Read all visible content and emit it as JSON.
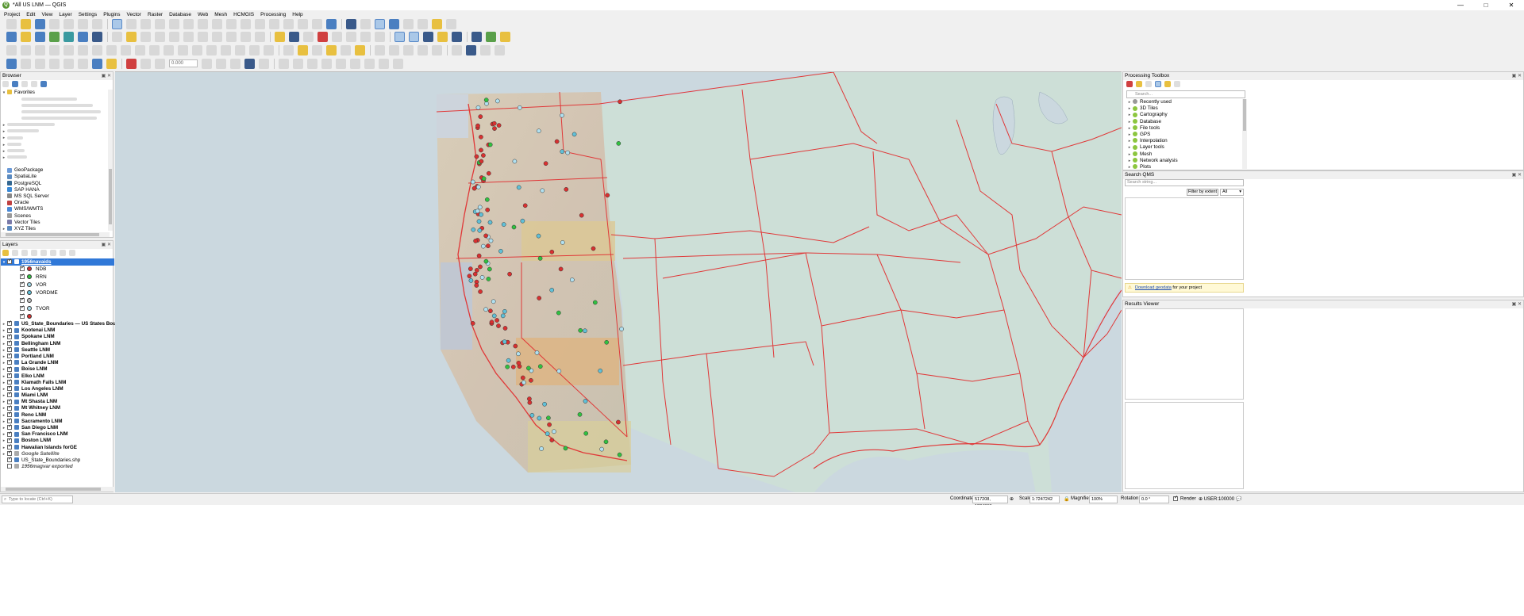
{
  "window": {
    "title": "*All US LNM — QGIS",
    "controls": [
      "—",
      "□",
      "✕"
    ]
  },
  "menu": [
    "Project",
    "Edit",
    "View",
    "Layer",
    "Settings",
    "Plugins",
    "Vector",
    "Raster",
    "Database",
    "Web",
    "Mesh",
    "HCMGIS",
    "Processing",
    "Help"
  ],
  "toolbar": {
    "buffer_value": "0.000"
  },
  "browser": {
    "title": "Browser",
    "favorites_label": "Favorites",
    "items": [
      "GeoPackage",
      "SpatiaLite",
      "PostgreSQL",
      "SAP HANA",
      "MS SQL Server",
      "Oracle",
      "WMS/WMTS",
      "Scenes",
      "Vector Tiles",
      "XYZ Tiles"
    ]
  },
  "layers": {
    "title": "Layers",
    "group_layer": "1956navaids",
    "legend_items": [
      {
        "label": "NDB",
        "color": "#d83030"
      },
      {
        "label": "RRN",
        "color": "#30c040"
      },
      {
        "label": "VOR",
        "color": "#a0d8e8"
      },
      {
        "label": "VORDME",
        "color": "#60c0d8"
      },
      {
        "label": "",
        "color": "#c0c0c0"
      },
      {
        "label": "TVOR",
        "color": "#b0e0f0"
      },
      {
        "label": "",
        "color": "#d83030"
      }
    ],
    "items": [
      {
        "label": "US_State_Boundaries — US States Boundari",
        "style": "bold"
      },
      {
        "label": "Kootenai LNM",
        "style": "bold"
      },
      {
        "label": "Spokane LNM",
        "style": "bold"
      },
      {
        "label": "Bellingham LNM",
        "style": "bold"
      },
      {
        "label": "Seattle LNM",
        "style": "bold"
      },
      {
        "label": "Portland LNM",
        "style": "bold"
      },
      {
        "label": "La Grande LNM",
        "style": "bold"
      },
      {
        "label": "Boise LNM",
        "style": "bold"
      },
      {
        "label": "Elko LNM",
        "style": "bold"
      },
      {
        "label": "Klamath Falls LNM",
        "style": "bold"
      },
      {
        "label": "Los Angeles LNM",
        "style": "bold"
      },
      {
        "label": "Miami LNM",
        "style": "bold"
      },
      {
        "label": "Mt Shasta LNM",
        "style": "bold"
      },
      {
        "label": "Mt Whitney LNM",
        "style": "bold"
      },
      {
        "label": "Reno LNM",
        "style": "bold"
      },
      {
        "label": "Sacramento LNM",
        "style": "bold"
      },
      {
        "label": "San Diego LNM",
        "style": "bold"
      },
      {
        "label": "San Francisco LNM",
        "style": "bold"
      },
      {
        "label": "Boston LNM",
        "style": "bold"
      },
      {
        "label": "Hawaiian Islands forGE",
        "style": "bold"
      },
      {
        "label": "Google Satellite",
        "style": "italic"
      },
      {
        "label": "US_State_Boundaries.shp",
        "style": "normal"
      },
      {
        "label": "1956magvar exported",
        "style": "italic"
      }
    ]
  },
  "processing": {
    "title": "Processing Toolbox",
    "search_placeholder": "Search...",
    "items": [
      "Recently used",
      "3D Tiles",
      "Cartography",
      "Database",
      "File tools",
      "GPS",
      "Interpolation",
      "Layer tools",
      "Mesh",
      "Network analysis",
      "Plots"
    ]
  },
  "search_qms": {
    "title": "Search QMS",
    "placeholder": "Search string...",
    "filter_button": "Filter by extent",
    "filter_select": "All",
    "notice_link": "Download geodata",
    "notice_text": " for your project"
  },
  "results_viewer": {
    "title": "Results Viewer"
  },
  "statusbar": {
    "locator_placeholder": "Type to locate (Ctrl+K)",
    "coordinate_label": "Coordinate",
    "coordinate_value": "517208, 1224993",
    "scale_label": "Scale",
    "scale_value": "1:7247242",
    "magnifier_label": "Magnifier",
    "magnifier_value": "100%",
    "rotation_label": "Rotation",
    "rotation_value": "0.0 °",
    "render_label": "Render",
    "crs_label": "USER:100000"
  },
  "colors": {
    "map_background": "#cbd8df",
    "land": "#cddfd7",
    "state_boundary": "#e03838",
    "selection": "#3078d8"
  }
}
